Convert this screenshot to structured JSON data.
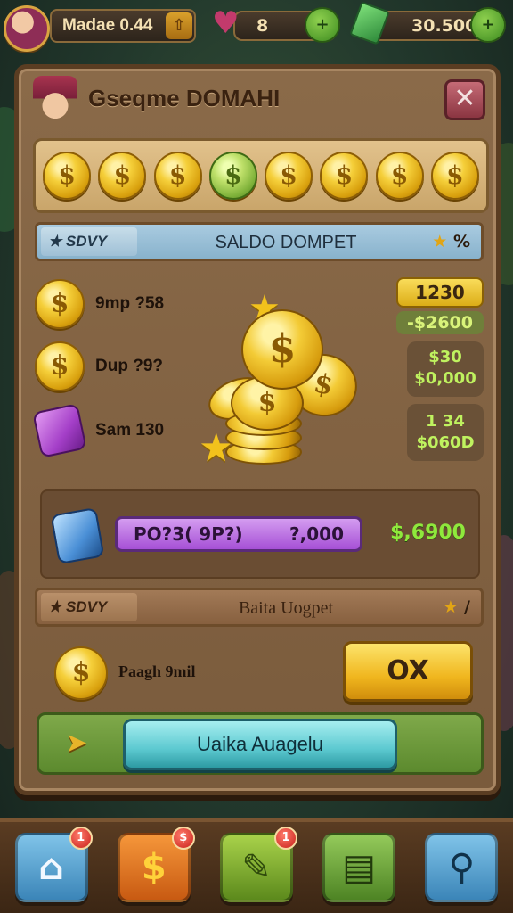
{
  "hud": {
    "player_name": "Madae 0.44",
    "hearts": "8",
    "gems": "30.500"
  },
  "panel": {
    "title": "Gseqme DOMAHI",
    "close_glyph": "✕"
  },
  "coin_row": {
    "coins": [
      "$",
      "$",
      "$",
      "$",
      "$",
      "$",
      "$",
      "$"
    ],
    "highlighted_index": 3
  },
  "wallet_banner": {
    "tag": "SDVY",
    "title": "SALDO DOMPET",
    "end": "%"
  },
  "balances": [
    {
      "icon": "gold-coin-icon",
      "label": "9mp ?58"
    },
    {
      "icon": "gold-coin-icon",
      "label": "Dup ?9?"
    },
    {
      "icon": "purple-gem-icon",
      "label": "Sam 130"
    }
  ],
  "values": {
    "a_top": "1230",
    "a_bottom": "-$2600",
    "b_top": "$30",
    "b_bottom": "$0,000",
    "c_top": "1 34",
    "c_bottom": "$060D"
  },
  "progress": {
    "left_text": "PO?3( 9P?)",
    "right_text": "?,000",
    "value": "$,6900"
  },
  "second_banner": {
    "tag": "SDVY",
    "title": "Baita Uogpet",
    "end": "/"
  },
  "ok_row": {
    "label": "Paagh 9mil",
    "ok_label": "OX"
  },
  "action": {
    "confirm_label": "Uaika Auagelu"
  },
  "nav": [
    {
      "name": "home",
      "glyph": "⌂",
      "badge": "1"
    },
    {
      "name": "shop",
      "glyph": "$",
      "badge": "$"
    },
    {
      "name": "quests",
      "glyph": "✎",
      "badge": "1"
    },
    {
      "name": "inventory",
      "glyph": "▤",
      "badge": ""
    },
    {
      "name": "search",
      "glyph": "⚲",
      "badge": ""
    }
  ],
  "colors": {
    "panel": "#7a5b3c",
    "coin_gold": "#f5cf3a",
    "accent_green": "#8fe83c",
    "ok_yellow": "#f0b61e",
    "confirm_teal": "#5cc9d0"
  }
}
